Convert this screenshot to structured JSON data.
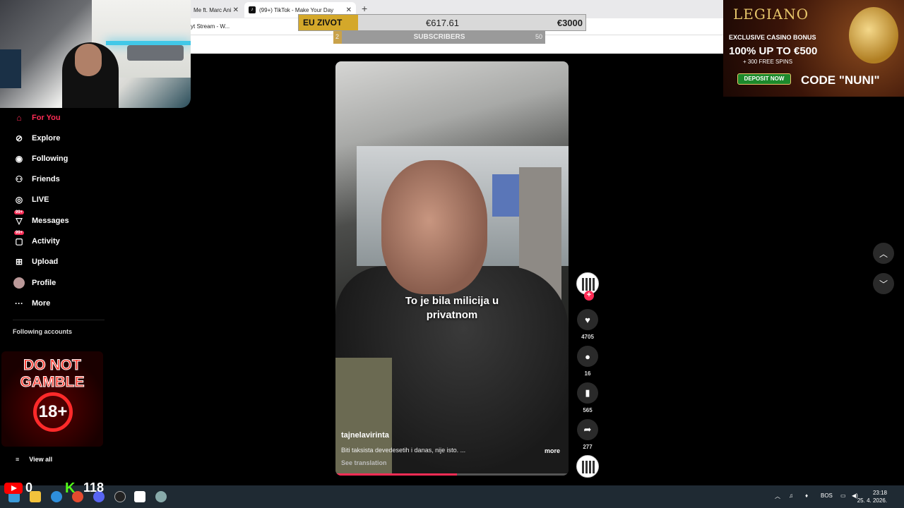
{
  "browser": {
    "tabs": [
      {
        "title": "Me ft. Marc Ani",
        "close": "✕"
      },
      {
        "title": "(99+) TikTok - Make Your Day",
        "close": "✕"
      }
    ],
    "new_tab": "+",
    "bookmark": "yt Stream - W..."
  },
  "goal": {
    "label": "EU ZIVOT",
    "current": "€617.61",
    "target": "€3000",
    "current_fraction": 0.206
  },
  "subscribers": {
    "min": "2",
    "label": "SUBSCRIBERS",
    "max": "50",
    "fraction": 0.04
  },
  "sidebar": {
    "items": [
      {
        "label": "For You",
        "icon": "home-icon"
      },
      {
        "label": "Explore",
        "icon": "compass-icon"
      },
      {
        "label": "Following",
        "icon": "following-icon"
      },
      {
        "label": "Friends",
        "icon": "friends-icon"
      },
      {
        "label": "LIVE",
        "icon": "live-icon"
      },
      {
        "label": "Messages",
        "icon": "messages-icon",
        "badge": "99+"
      },
      {
        "label": "Activity",
        "icon": "activity-icon",
        "badge": "99+"
      },
      {
        "label": "Upload",
        "icon": "upload-icon"
      },
      {
        "label": "Profile",
        "icon": "profile-avatar"
      },
      {
        "label": "More",
        "icon": "more-icon"
      }
    ],
    "following_header": "Following accounts",
    "view_all": "View all"
  },
  "gamble_banner": {
    "line1": "DO NOT",
    "line2": "GAMBLE",
    "age": "18+"
  },
  "video": {
    "caption_line1": "To je bila milicija u",
    "caption_line2": "privatnom",
    "author": "tajnelavirinta",
    "description": "Biti taksista devedesetih i danas, nije isto. ...",
    "more": "more",
    "see_translation": "See translation",
    "progress": 0.52
  },
  "actions": {
    "likes": "4705",
    "comments": "16",
    "saves": "565",
    "shares": "277"
  },
  "casino_ad": {
    "brand": "LEGIANO",
    "line1": "EXCLUSIVE CASINO BONUS",
    "line2": "100% UP TO €500",
    "line3": "+ 300 FREE SPINS",
    "button": "DEPOSIT NOW",
    "code": "CODE \"NUNI\""
  },
  "stream_stats": {
    "youtube_viewers": "0",
    "kick_logo": "K",
    "kick_viewers": "118"
  },
  "taskbar": {
    "language": "BOS",
    "time": "23:18",
    "date": "25. 4. 2026."
  },
  "colors": {
    "accent": "#fe2c55",
    "goal_bar": "#d4a82a",
    "taskbar": "#1f2a33"
  }
}
